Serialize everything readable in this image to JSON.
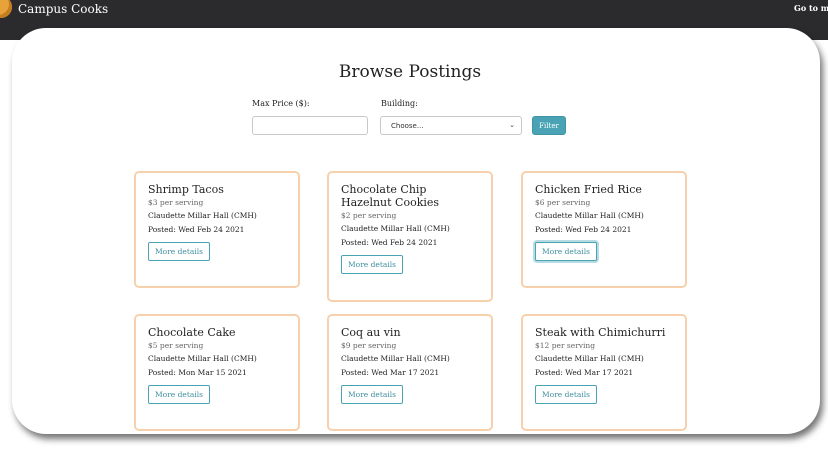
{
  "navbar": {
    "brand_name": "Campus Cooks",
    "profile_link": "Go to my profile"
  },
  "page": {
    "title": "Browse Postings"
  },
  "filters": {
    "price_label": "Max Price ($):",
    "price_value": "",
    "building_label": "Building:",
    "building_selected": "Choose...",
    "filter_button": "Filter"
  },
  "postings": [
    {
      "title": "Shrimp Tacos",
      "price": "$3 per serving",
      "building": "Claudette Millar Hall (CMH)",
      "posted": "Posted: Wed Feb 24 2021",
      "button": "More details"
    },
    {
      "title": "Chocolate Chip Hazelnut Cookies",
      "price": "$2 per serving",
      "building": "Claudette Millar Hall (CMH)",
      "posted": "Posted: Wed Feb 24 2021",
      "button": "More details"
    },
    {
      "title": "Chicken Fried Rice",
      "price": "$6 per serving",
      "building": "Claudette Millar Hall (CMH)",
      "posted": "Posted: Wed Feb 24 2021",
      "button": "More details"
    },
    {
      "title": "Chocolate Cake",
      "price": "$5 per serving",
      "building": "Claudette Millar Hall (CMH)",
      "posted": "Posted: Mon Mar 15 2021",
      "button": "More details"
    },
    {
      "title": "Coq au vin",
      "price": "$9 per serving",
      "building": "Claudette Millar Hall (CMH)",
      "posted": "Posted: Wed Mar 17 2021",
      "button": "More details"
    },
    {
      "title": "Steak with Chimichurri",
      "price": "$12 per serving",
      "building": "Claudette Millar Hall (CMH)",
      "posted": "Posted: Wed Mar 17 2021",
      "button": "More details"
    }
  ],
  "colors": {
    "navbar": "#2b2b2e",
    "card_border": "#f7d1ad",
    "accent": "#49a3b5"
  }
}
